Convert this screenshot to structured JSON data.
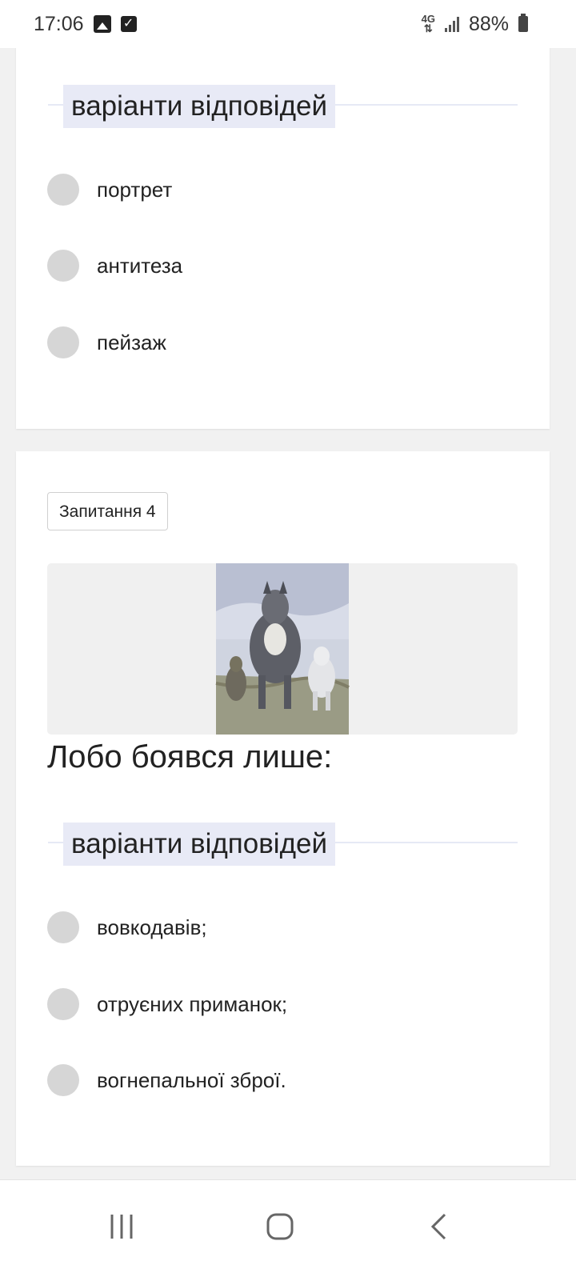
{
  "status_bar": {
    "time": "17:06",
    "network": "4G",
    "battery": "88%",
    "icons": [
      "gallery-icon",
      "task-check-icon",
      "network-4g-icon",
      "signal-icon",
      "battery-icon"
    ]
  },
  "card1": {
    "section_label": "варіанти відповідей",
    "options": [
      "портрет",
      "антитеза",
      "пейзаж"
    ]
  },
  "card2": {
    "question_badge": "Запитання 4",
    "image_subject": "illustration of three wolves walking toward viewer",
    "question_text": "Лобо боявся лише:",
    "section_label": "варіанти відповідей",
    "options": [
      "вовкодавів;",
      "отруєних приманок;",
      "вогнепальної зброї."
    ]
  },
  "nav_bar": {
    "icons": [
      "recent-apps-icon",
      "home-icon",
      "back-icon"
    ]
  },
  "colors": {
    "page_bg": "#f1f1f1",
    "card_bg": "#ffffff",
    "section_label_bg": "#e8eaf6",
    "radio_fill": "#d6d6d6"
  }
}
